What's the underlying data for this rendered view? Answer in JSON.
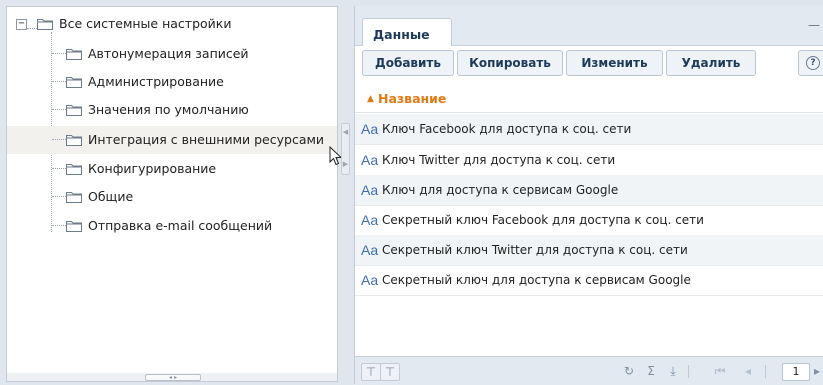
{
  "tree": {
    "root": {
      "label": "Все системные настройки",
      "expander": "⊟"
    },
    "items": [
      {
        "label": "Автонумерация записей"
      },
      {
        "label": "Администрирование"
      },
      {
        "label": "Значения по умолчанию"
      },
      {
        "label": "Интеграция с внешними ресурсами"
      },
      {
        "label": "Конфигурирование"
      },
      {
        "label": "Общие"
      },
      {
        "label": "Отправка e-mail сообщений"
      }
    ]
  },
  "tabs": [
    {
      "label": "Данные",
      "active": true
    }
  ],
  "toolbar": {
    "add_label": "Добавить",
    "copy_label": "Копировать",
    "edit_label": "Изменить",
    "delete_label": "Удалить"
  },
  "grid": {
    "header": {
      "sort_indicator": "▲",
      "column": "Название"
    },
    "type_icon": "Aa",
    "rows": [
      "Ключ Facebook для доступа к соц. сети",
      "Ключ Twitter для доступа к соц. сети",
      "Ключ для доступа к сервисам Google",
      "Секретный ключ Facebook для доступа к соц. сети",
      "Секретный ключ Twitter для доступа к соц. сети",
      "Секретный ключ для доступа к сервисам Google"
    ]
  },
  "footer": {
    "page": "1"
  },
  "colors": {
    "accent": "#e07a14",
    "header_text": "#1e3a5a",
    "type_icon": "#3d6fb3",
    "panel_bg": "#e2e9f1"
  }
}
